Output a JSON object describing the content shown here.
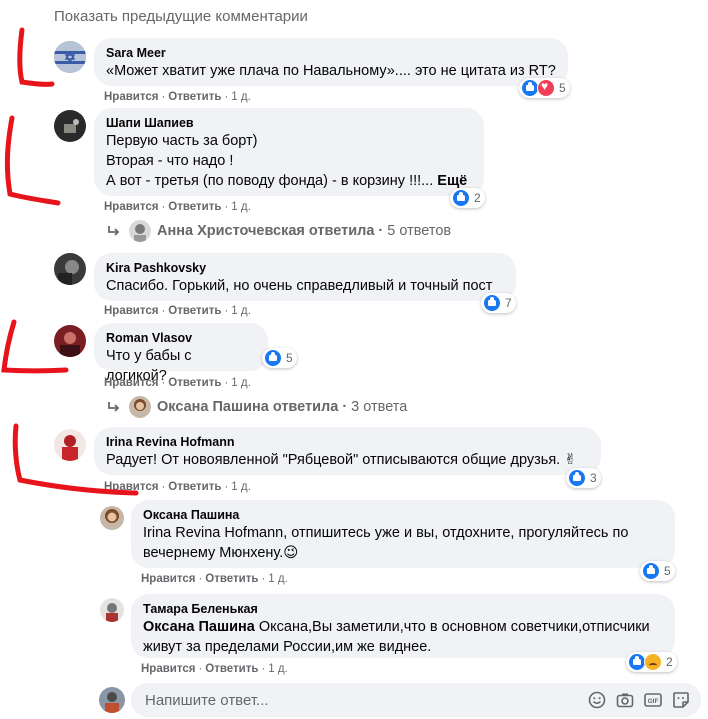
{
  "prev_comments_link": "Показать предыдущие комментарии",
  "comments": [
    {
      "author": "Sara Meer",
      "text": "«Может хватит уже плача по Навальному».... это не цитата из RT?",
      "like_label": "Нравится",
      "reply_label": "Ответить",
      "time": "1 д.",
      "reactions": [
        "like",
        "love"
      ],
      "reaction_count": "5"
    },
    {
      "author": "Шапи Шапиев",
      "text": "Первую часть за борт)\nВторая - что надо !\nА вот - третья (по поводу фонда) - в корзину !!!...",
      "more_label": "Ещё",
      "like_label": "Нравится",
      "reply_label": "Ответить",
      "time": "1 д.",
      "reactions": [
        "like"
      ],
      "reaction_count": "2",
      "replies_summary": "Анна Христочевская ответила",
      "replies_count": "5 ответов"
    },
    {
      "author": "Kira Pashkovsky",
      "text": "Спасибо. Горький, но очень справедливый и точный пост",
      "like_label": "Нравится",
      "reply_label": "Ответить",
      "time": "1 д.",
      "reactions": [
        "like"
      ],
      "reaction_count": "7"
    },
    {
      "author": "Roman Vlasov",
      "text": "Что у бабы с логикой?",
      "like_label": "Нравится",
      "reply_label": "Ответить",
      "time": "1 д.",
      "reactions": [
        "like"
      ],
      "reaction_count": "5",
      "replies_summary": "Оксана Пашина ответила",
      "replies_count": "3 ответа"
    },
    {
      "author": "Irina Revina Hofmann",
      "text": "Радует! От новоявленной \"Рябцевой\" отписываются общие друзья. ✌",
      "like_label": "Нравится",
      "reply_label": "Ответить",
      "time": "1 д.",
      "reactions": [
        "like"
      ],
      "reaction_count": "3"
    }
  ],
  "replies": [
    {
      "author": "Оксана Пашина",
      "text": "Irina Revina Hofmann, отпишитесь уже и вы, отдохните, прогуляйтесь по вечернему Мюнхену.😉",
      "like_label": "Нравится",
      "reply_label": "Ответить",
      "time": "1 д.",
      "reactions": [
        "like"
      ],
      "reaction_count": "5"
    },
    {
      "author": "Тамара Беленькая",
      "mention": "Оксана Пашина",
      "text": " Оксана,Вы заметили,что в основном советчики,отписчики живут за пределами России,им же виднее.",
      "like_label": "Нравится",
      "reply_label": "Ответить",
      "time": "1 д.",
      "reactions": [
        "like",
        "sad"
      ],
      "reaction_count": "2"
    }
  ],
  "reply_input": {
    "placeholder": "Напишите ответ..."
  },
  "input_tools": [
    "emoji-icon",
    "camera-icon",
    "gif-icon",
    "sticker-icon"
  ],
  "colors": {
    "bubble": "#f0f2f5",
    "secondary_text": "#65676b",
    "like": "#1877f2",
    "love": "#f33e58",
    "annotation_red": "#e8141b"
  }
}
